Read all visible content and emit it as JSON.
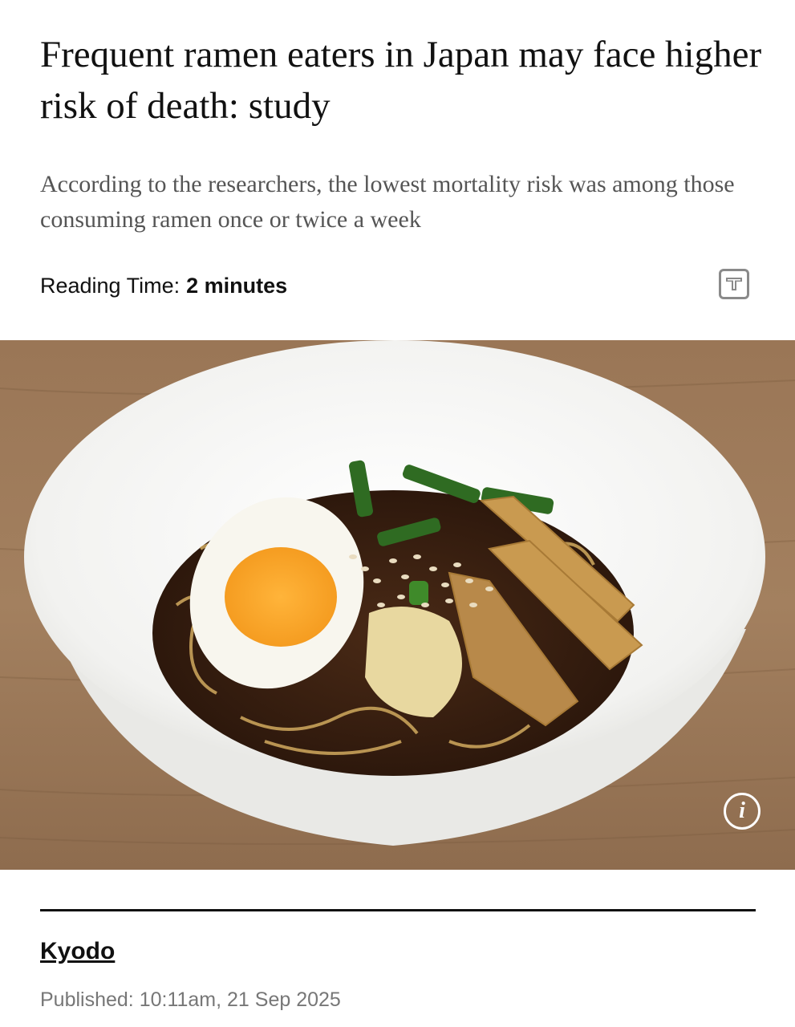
{
  "article": {
    "headline": "Frequent ramen eaters in Japan may face higher risk of death: study",
    "subheadline": "According to the researchers, the lowest mortality risk was among those consuming ramen once or twice a week",
    "reading_time_label": "Reading Time:",
    "reading_time_value": "2 minutes",
    "text_size_icon": "text-size-icon",
    "image_alt": "Bowl of ramen with soft-boiled egg, green onions, sesame seeds and bamboo shoots",
    "info_icon_glyph": "i",
    "author": "Kyodo",
    "published": "Published: 10:11am, 21 Sep 2025"
  },
  "colors": {
    "text": "#111111",
    "subtext": "#555555",
    "meta": "#777777",
    "divider": "#111111"
  }
}
